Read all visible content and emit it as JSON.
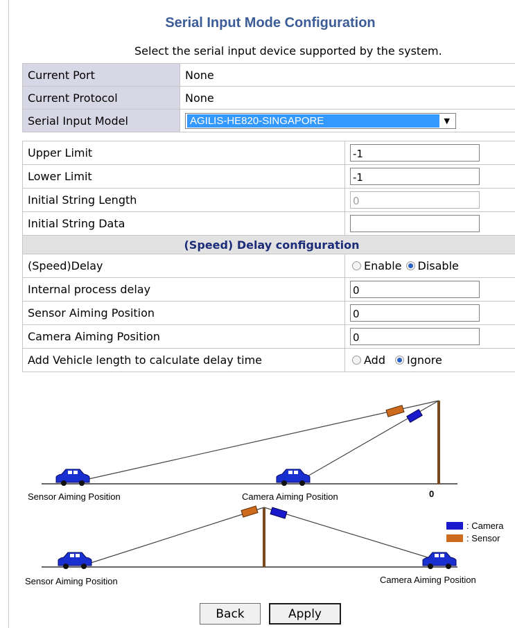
{
  "title": "Serial Input Mode Configuration",
  "subtitle": "Select the serial input device supported by the system.",
  "port": {
    "current_port_label": "Current Port",
    "current_port_value": "None",
    "current_protocol_label": "Current Protocol",
    "current_protocol_value": "None",
    "model_label": "Serial Input Model",
    "model_value": "AGILIS-HE820-SINGAPORE"
  },
  "fields": {
    "upper_limit_label": "Upper Limit",
    "upper_limit_value": "-1",
    "lower_limit_label": "Lower Limit",
    "lower_limit_value": "-1",
    "init_len_label": "Initial String Length",
    "init_len_value": "0",
    "init_data_label": "Initial String Data",
    "init_data_value": ""
  },
  "delay": {
    "section_title": "(Speed) Delay configuration",
    "speed_delay_label": "(Speed)Delay",
    "enable_label": "Enable",
    "disable_label": "Disable",
    "speed_delay_selected": "Disable",
    "internal_delay_label": "Internal process delay",
    "internal_delay_value": "0",
    "sensor_aiming_label": "Sensor Aiming Position",
    "sensor_aiming_value": "0",
    "camera_aiming_label": "Camera Aiming Position",
    "camera_aiming_value": "0",
    "vehicle_length_label": "Add Vehicle length to calculate delay time",
    "add_label": "Add",
    "ignore_label": "Ignore",
    "vehicle_length_selected": "Ignore"
  },
  "diagram": {
    "top_sensor_label": "Sensor Aiming Position",
    "top_camera_label": "Camera Aiming Position",
    "zero_label": "0",
    "bottom_sensor_label": "Sensor Aiming Position",
    "bottom_camera_label": "Camera Aiming Position",
    "legend_camera": ": Camera",
    "legend_sensor": ": Sensor",
    "camera_color": "#1a1acc",
    "sensor_color": "#cc6a1e",
    "pole_color": "#7a4a1e"
  },
  "buttons": {
    "back": "Back",
    "apply": "Apply"
  }
}
